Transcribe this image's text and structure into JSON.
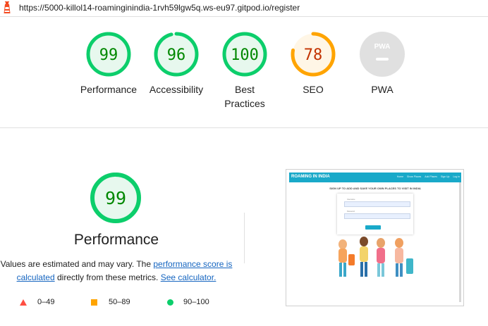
{
  "url": "https://5000-killol14-roaminginindia-1rvh59lgw5q.ws-eu97.gitpod.io/register",
  "colors": {
    "pass": "#0cce6b",
    "average": "#ffa400",
    "fail": "#ff4e42",
    "pwa_gray": "#e0e0e0"
  },
  "gauges": [
    {
      "score": "99",
      "label": "Performance",
      "fraction": 0.99
    },
    {
      "score": "96",
      "label": "Accessibility",
      "fraction": 0.96
    },
    {
      "score": "100",
      "label": "Best Practices",
      "fraction": 1.0
    },
    {
      "score": "78",
      "label": "SEO",
      "fraction": 0.78
    },
    {
      "score": "PWA",
      "label": "PWA"
    }
  ],
  "perf": {
    "score": "99",
    "fraction": 0.99,
    "title": "Performance",
    "desc_prefix": "Values are estimated and may vary. The ",
    "link_score": "performance score is calculated",
    "desc_middle": " directly from these metrics. ",
    "link_calc": "See calculator."
  },
  "legend": [
    {
      "range": "0–49",
      "icon": "triangle-icon"
    },
    {
      "range": "50–89",
      "icon": "square-icon"
    },
    {
      "range": "90–100",
      "icon": "circle-icon"
    }
  ],
  "thumbnail": {
    "brand": "ROAMING IN INDIA",
    "links": [
      "Home",
      "Show Places",
      "Add Places",
      "Sign Up",
      "Log in"
    ],
    "heading": "SIGN UP TO ADD AND SAVE YOUR OWN PLACES TO VISIT IN INDIA",
    "field1_label": "Username",
    "field2_label": "Password"
  }
}
